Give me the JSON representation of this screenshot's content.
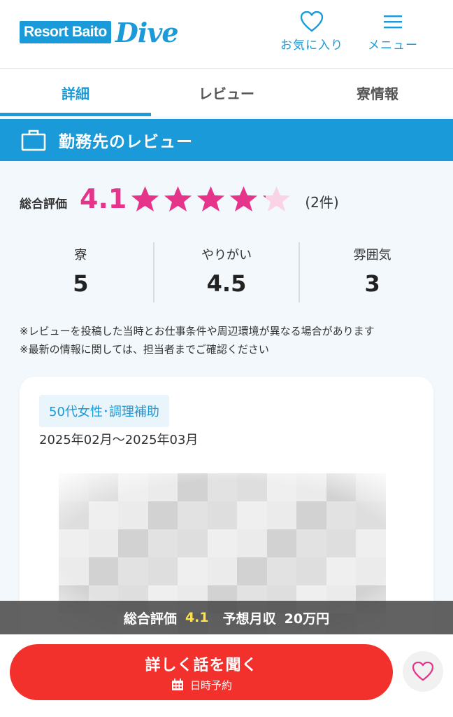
{
  "header": {
    "logo_box": "Resort Baito",
    "logo_text": "Dive",
    "favorites_label": "お気に入り",
    "menu_label": "メニュー"
  },
  "tabs": [
    {
      "label": "詳細",
      "active": true
    },
    {
      "label": "レビュー",
      "active": false
    },
    {
      "label": "寮情報",
      "active": false
    }
  ],
  "section": {
    "title": "勤務先のレビュー",
    "icon": "briefcase-icon"
  },
  "overall": {
    "label": "総合評価",
    "score": "4.1",
    "stars": 4.1,
    "count": "(2件)"
  },
  "sub_ratings": [
    {
      "label": "寮",
      "value": "5"
    },
    {
      "label": "やりがい",
      "value": "4.5"
    },
    {
      "label": "雰囲気",
      "value": "3"
    }
  ],
  "notes": [
    "※レビューを投稿した当時とお仕事条件や周辺環境が異なる場合があります",
    "※最新の情報に関しては、担当者までご確認ください"
  ],
  "review": {
    "tag": "50代女性･調理補助",
    "period": "2025年02月～2025年03月"
  },
  "summary": {
    "rating_label": "総合評価",
    "rating_value": "4.1",
    "income_label": "予想月収",
    "income_value": "20万円"
  },
  "cta": {
    "main_label": "詳しく話を聞く",
    "sub_label": "日時予約"
  },
  "colors": {
    "brand": "#1a9ad8",
    "star": "#e5348a",
    "cta": "#f2312d",
    "highlight": "#ffe24a"
  }
}
